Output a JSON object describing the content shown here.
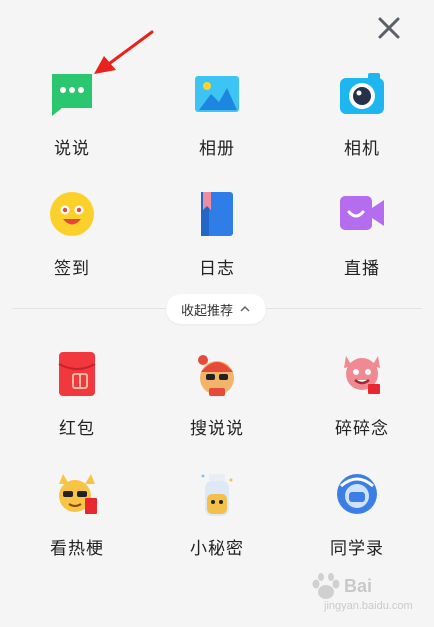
{
  "close": {
    "icon": "close-icon"
  },
  "grid_top": [
    {
      "label": "说说",
      "icon": "chat-bubble-icon",
      "color": "#2bc670"
    },
    {
      "label": "相册",
      "icon": "photo-album-icon",
      "color": "#3ec4f3"
    },
    {
      "label": "相机",
      "icon": "camera-icon",
      "color": "#1eb6f0"
    },
    {
      "label": "签到",
      "icon": "smiley-checkin-icon",
      "color": "#fbd02b"
    },
    {
      "label": "日志",
      "icon": "diary-book-icon",
      "color": "#2f7ee8"
    },
    {
      "label": "直播",
      "icon": "live-video-icon",
      "color": "#b56df0"
    }
  ],
  "collapse": {
    "label": "收起推荐",
    "icon": "chevron-up-icon"
  },
  "grid_bottom": [
    {
      "label": "红包",
      "icon": "red-envelope-icon",
      "color": "#f1383f"
    },
    {
      "label": "搜说说",
      "icon": "search-feed-character-icon",
      "color": "#e84a3a"
    },
    {
      "label": "碎碎念",
      "icon": "murmur-character-icon",
      "color": "#f08a92"
    },
    {
      "label": "看热梗",
      "icon": "hot-meme-character-icon",
      "color": "#f8c443"
    },
    {
      "label": "小秘密",
      "icon": "secret-bottle-icon",
      "color": "#f3c04c"
    },
    {
      "label": "同学录",
      "icon": "classmates-badge-icon",
      "color": "#3a7ee6"
    }
  ],
  "annotation": {
    "icon": "red-arrow-pointer-icon",
    "color": "#e8221c"
  },
  "watermark": {
    "text": "Bai",
    "subtext": "jingyan.baidu.com",
    "icon": "baidu-paw-logo"
  }
}
